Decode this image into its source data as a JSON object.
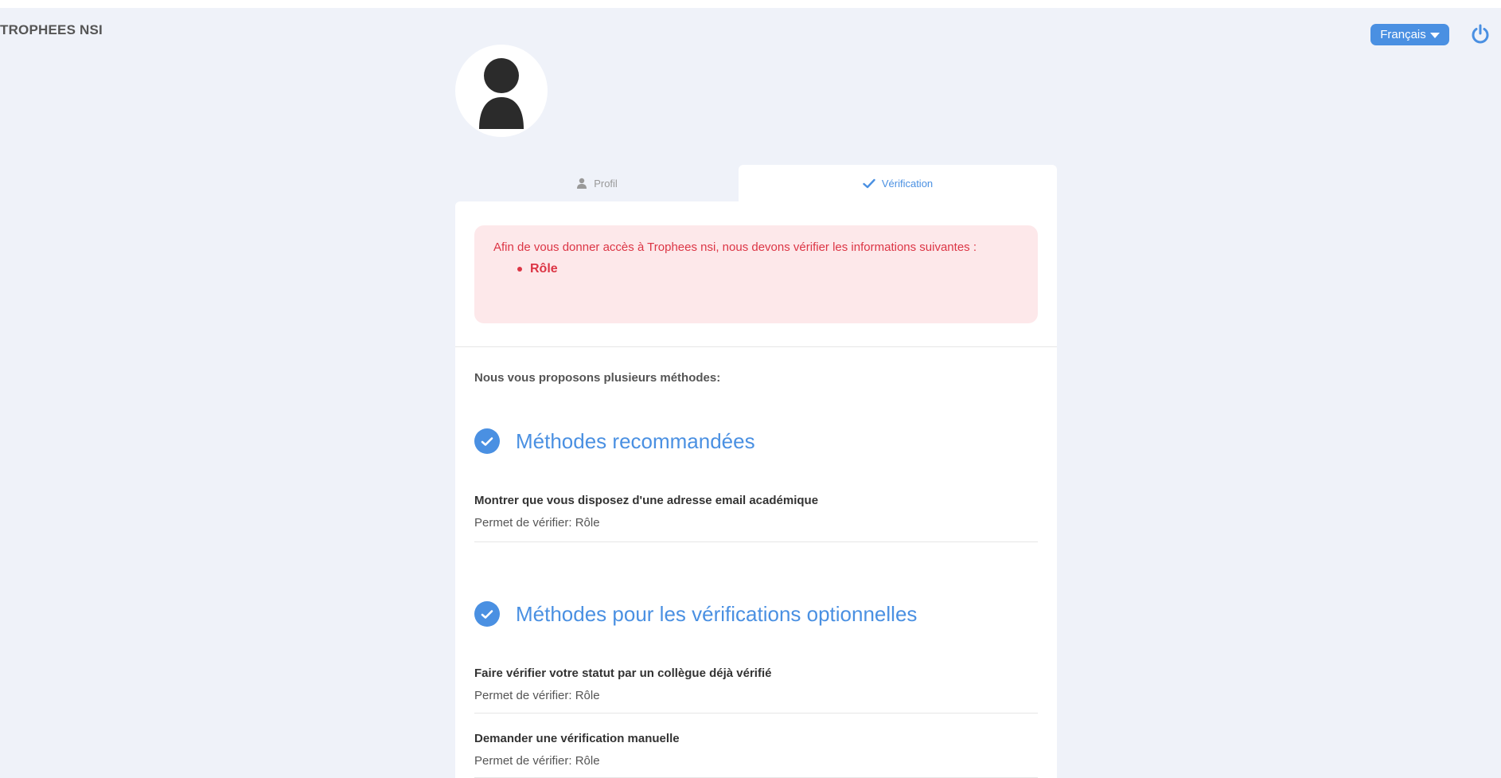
{
  "header": {
    "app_title": "TROPHEES NSI",
    "language_label": "Français"
  },
  "tabs": {
    "profil_label": "Profil",
    "verification_label": "Vérification"
  },
  "alert": {
    "message": "Afin de vous donner accès à Trophees nsi, nous devons vérifier les informations suivantes :",
    "items": [
      "Rôle"
    ]
  },
  "intro": "Nous vous proposons plusieurs méthodes:",
  "sections": [
    {
      "title": "Méthodes recommandées",
      "methods": [
        {
          "title": "Montrer que vous disposez d'une adresse email académique",
          "subtitle": "Permet de vérifier: Rôle"
        }
      ]
    },
    {
      "title": "Méthodes pour les vérifications optionnelles",
      "methods": [
        {
          "title": "Faire vérifier votre statut par un collègue déjà vérifié",
          "subtitle": "Permet de vérifier: Rôle"
        },
        {
          "title": "Demander une vérification manuelle",
          "subtitle": "Permet de vérifier: Rôle"
        }
      ]
    }
  ],
  "colors": {
    "accent": "#4a90e2",
    "alert_text": "#dc3545",
    "alert_bg": "#fde8ea",
    "page_bg": "#eff2f9"
  },
  "icons": {
    "avatar": "user-silhouette-icon",
    "profil_tab": "user-icon",
    "verification_tab": "check-icon",
    "section": "check-circle-icon",
    "power": "power-icon",
    "language_caret": "caret-down-icon"
  }
}
